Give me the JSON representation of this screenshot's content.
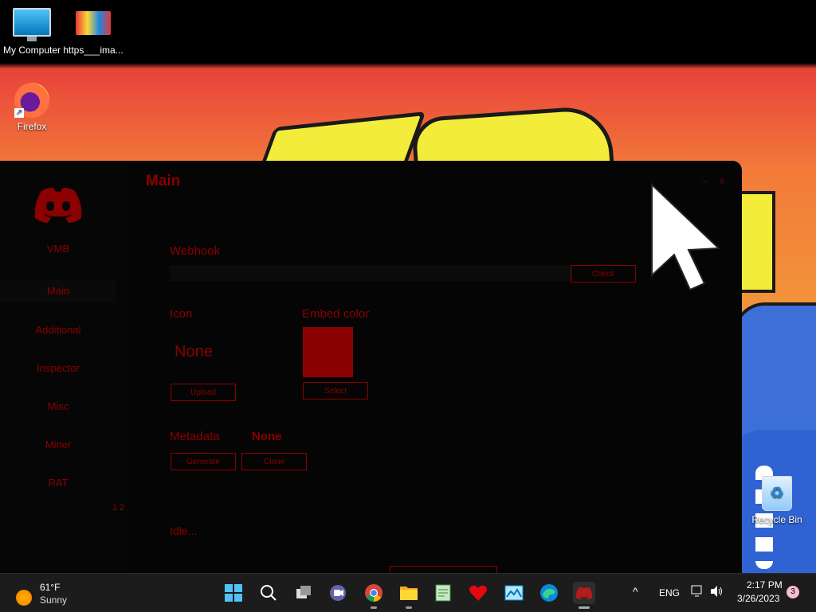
{
  "desktop": {
    "icons": [
      {
        "label": "My Computer"
      },
      {
        "label": "https___ima..."
      },
      {
        "label": "Firefox"
      },
      {
        "label": "Recycle Bin"
      }
    ]
  },
  "app": {
    "title": "Main",
    "window_controls": {
      "minimize": "–",
      "close": "x"
    },
    "nav": [
      {
        "label": "VMB"
      },
      {
        "label": "Main"
      },
      {
        "label": "Additional"
      },
      {
        "label": "Inspector"
      },
      {
        "label": "Misc"
      },
      {
        "label": "Miner"
      },
      {
        "label": "RAT"
      }
    ],
    "pager": "1 2",
    "webhook": {
      "label": "Webhook",
      "value": "",
      "check_button": "Check"
    },
    "icon_section": {
      "label": "Icon",
      "value": "None",
      "upload_button": "Upload"
    },
    "embed_color": {
      "label": "Embed color",
      "color": "#8b0000",
      "select_button": "Select"
    },
    "metadata": {
      "label": "Metadata",
      "value": "None",
      "generate_button": "Generate",
      "clone_button": "Clone"
    },
    "status": "Idle..."
  },
  "taskbar": {
    "weather": {
      "temp": "61°F",
      "condition": "Sunny"
    },
    "apps": [
      "windows-start-icon",
      "search-icon",
      "task-view-icon",
      "teams-chat-icon",
      "chrome-icon",
      "file-explorer-icon",
      "notepad-icon",
      "heart-app-icon",
      "photos-icon",
      "edge-icon",
      "app-icon"
    ],
    "tray": {
      "chevron": "^",
      "language": "ENG",
      "time": "2:17 PM",
      "date": "3/26/2023",
      "notification_count": "3"
    }
  },
  "colors": {
    "accent": "#8b0000",
    "app_bg": "#050505",
    "taskbar_bg": "#1c1c1c"
  }
}
